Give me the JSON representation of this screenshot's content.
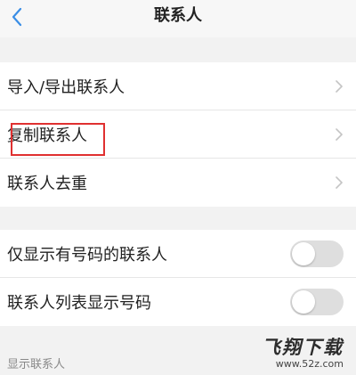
{
  "header": {
    "title": "联系人",
    "back_icon": "chevron-left-icon",
    "accent_color": "#3a8ee6"
  },
  "group1": {
    "items": [
      {
        "label": "导入/导出联系人",
        "icon": "chevron-right-icon"
      },
      {
        "label": "复制联系人",
        "icon": "chevron-right-icon",
        "highlighted": true
      },
      {
        "label": "联系人去重",
        "icon": "chevron-right-icon"
      }
    ]
  },
  "group2": {
    "items": [
      {
        "label": "仅显示有号码的联系人",
        "toggle_on": false
      },
      {
        "label": "联系人列表显示号码",
        "toggle_on": false
      }
    ]
  },
  "section3": {
    "header": "显示联系人"
  },
  "watermark": {
    "main": "飞翔下载",
    "url": "www.52z.com"
  },
  "colors": {
    "highlight_box": "#e03030",
    "toggle_off": "#dedede"
  }
}
